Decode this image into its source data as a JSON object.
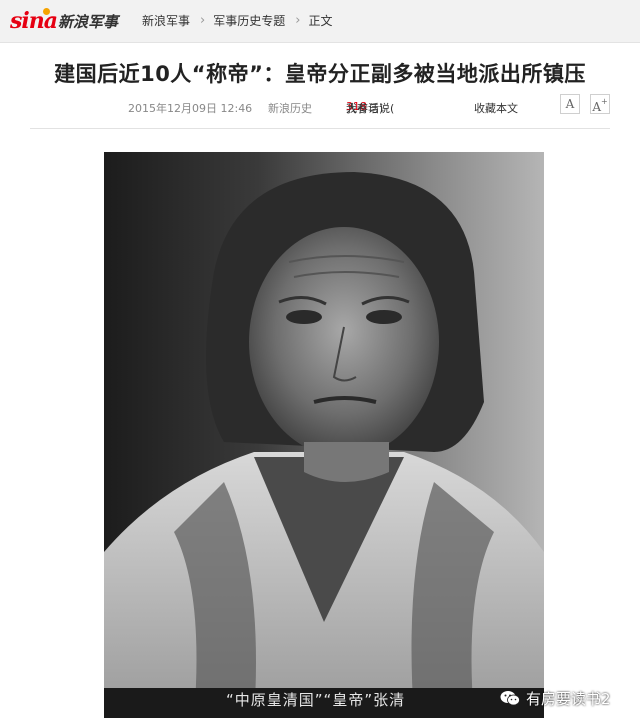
{
  "brand": {
    "logo_latin": "sina",
    "logo_name": "新浪军事"
  },
  "breadcrumb": [
    {
      "label": "新浪军事"
    },
    {
      "label": "军事历史专题"
    },
    {
      "label": "正文"
    }
  ],
  "article": {
    "title": "建国后近10人“称帝”：皇帝分正副多被当地派出所镇压",
    "date": "2015年12月09日 12:46",
    "source": "新浪历史",
    "comment_prefix": "我有话说(",
    "comment_count": "318",
    "comment_suffix": "人参与)",
    "favorite": "收藏本文",
    "font_small": "A",
    "font_large": "A",
    "font_large_sup": "+"
  },
  "photo": {
    "caption": "“中原皇清国”“皇帝”张清"
  },
  "watermark": {
    "text": "有房要读书2",
    "icon": "wechat-icon"
  },
  "colors": {
    "accent": "#e60012",
    "logo_eye": "#f5a300"
  }
}
